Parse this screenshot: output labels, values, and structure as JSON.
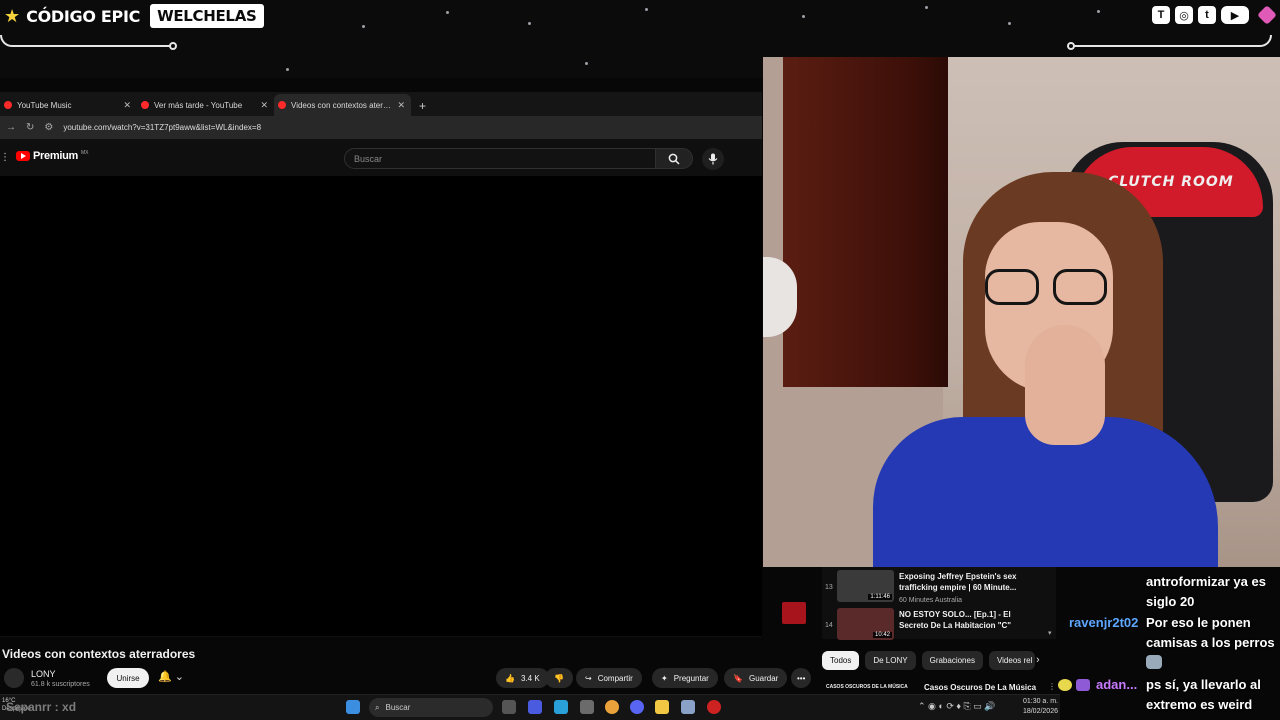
{
  "overlay": {
    "brand_code": "CÓDIGO EPIC",
    "brand_name": "WELCHELAS"
  },
  "browser": {
    "tabs": [
      {
        "title": "YouTube Music",
        "active": false
      },
      {
        "title": "Ver más tarde - YouTube",
        "active": false
      },
      {
        "title": "Videos con contextos aterradores",
        "active": true
      }
    ],
    "url": "youtube.com/watch?v=31TZ7pt9aww&list=WL&index=8",
    "logo_text": "Premium",
    "logo_region": "MX",
    "search_placeholder": "Buscar"
  },
  "video": {
    "title": "Videos con contextos aterradores",
    "channel": "LONY",
    "subscribers": "61.8 k suscriptores",
    "join_label": "Unirse",
    "likes": "3.4 K",
    "share_label": "Compartir",
    "ask_label": "Preguntar",
    "save_label": "Guardar"
  },
  "playlist": [
    {
      "num": "13",
      "title": "Exposing Jeffrey Epstein's sex trafficking empire | 60 Minute...",
      "channel": "60 Minutes Australia",
      "duration": "1:11:46"
    },
    {
      "num": "14",
      "title": "NO ESTOY SOLO... [Ep.1] - El Secreto De La Habitacion \"C\"",
      "channel": "",
      "duration": "10:42"
    }
  ],
  "chips": [
    "Todos",
    "De LONY",
    "Grabaciones",
    "Videos rel"
  ],
  "next_row": {
    "thumb_text": "CASOS OSCUROS DE LA MÚSICA",
    "title": "Casos Oscuros De La Música"
  },
  "chat": {
    "line1": "antroformizar ya es",
    "line2": "siglo 20",
    "user1": "ravenjr2t02",
    "msg1a": "Por eso le ponen",
    "msg1b": "camisas a los perros",
    "user2": "adan...",
    "msg2a": "ps sí, ya llevarlo al",
    "msg2b": "extremo es weird"
  },
  "taskbar": {
    "search_label": "Buscar",
    "time": "01:30 a. m.",
    "date": "18/02/2026",
    "weather_temp": "16°C",
    "weather_desc": "Despejado"
  },
  "ghost_chat": "Sepanrr : xd",
  "webcam": {
    "chair_text": "CLUTCH ROOM"
  }
}
